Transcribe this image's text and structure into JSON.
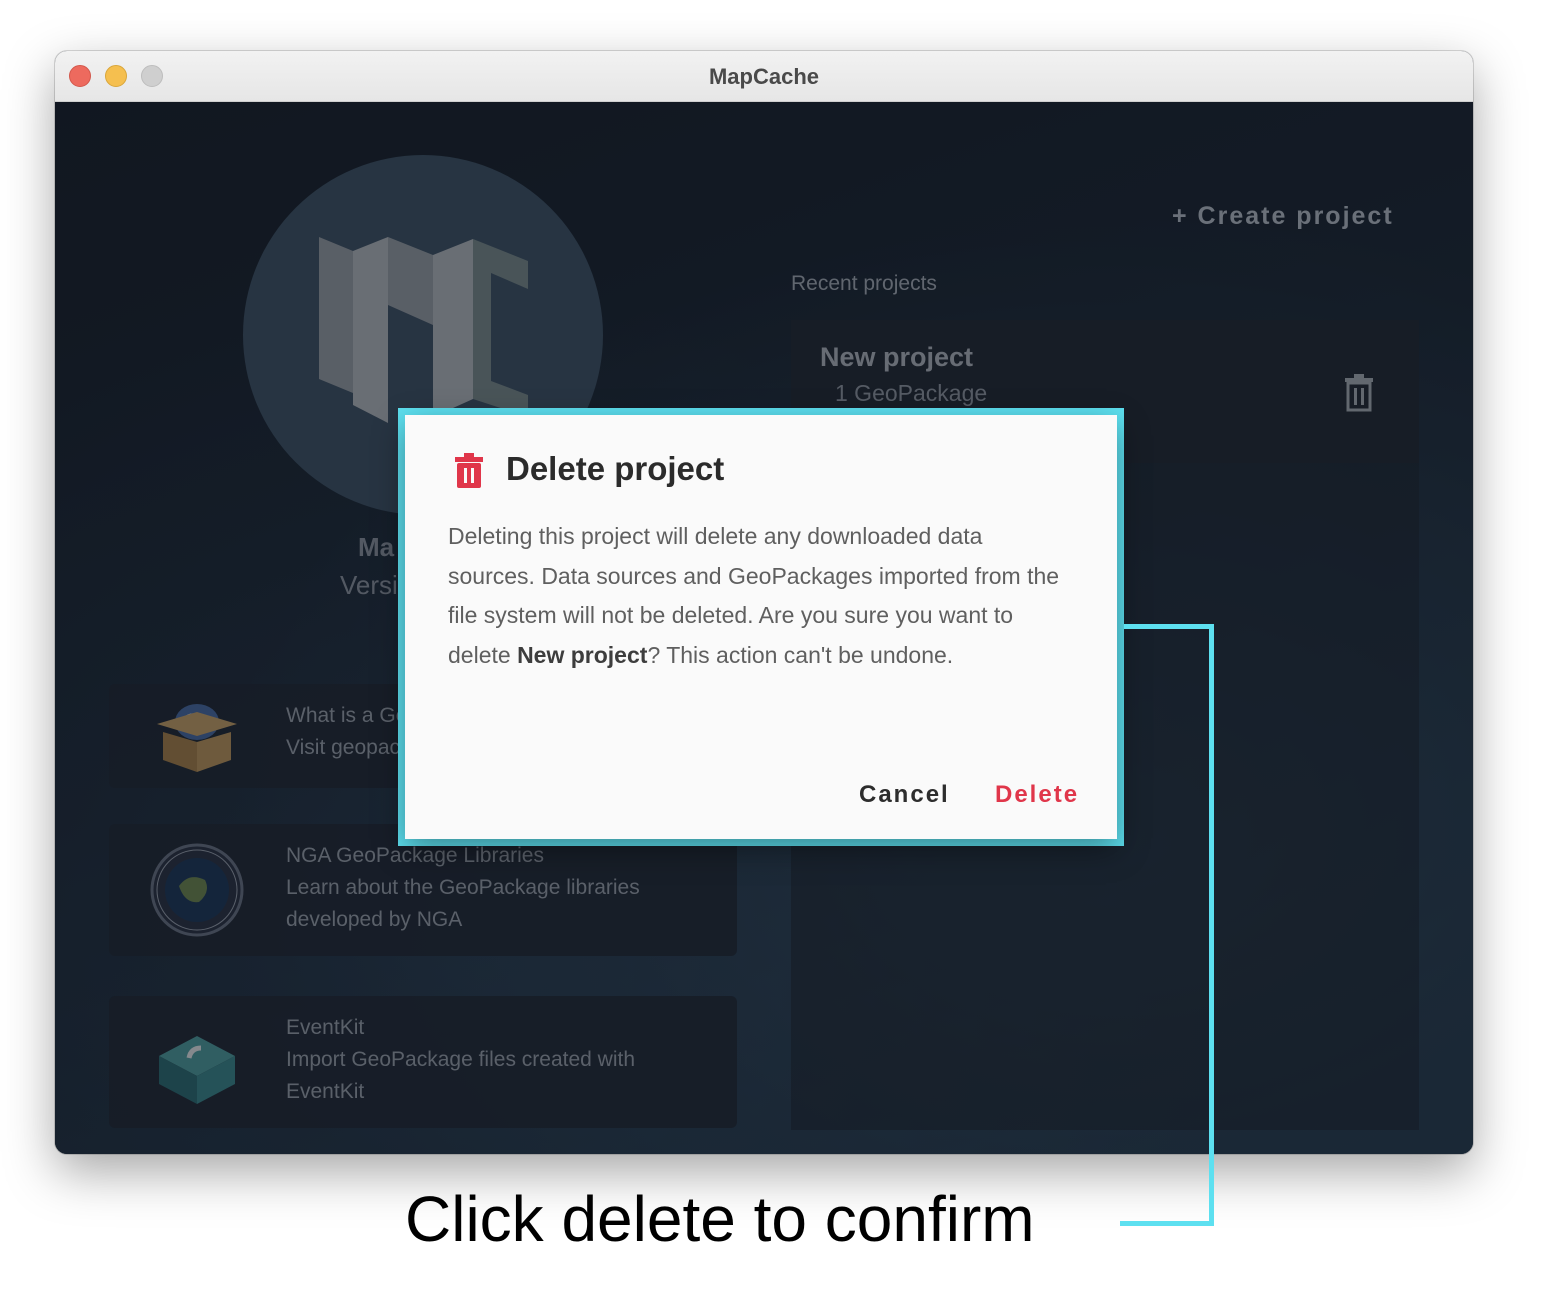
{
  "window": {
    "title": "MapCache"
  },
  "background": {
    "app_name_partial": "Ma",
    "version_partial": "Versi",
    "create_project_label": "+ Create project",
    "recent_projects_label": "Recent projects",
    "project": {
      "name": "New project",
      "subtitle": "1 GeoPackage"
    },
    "cards": [
      {
        "title": "What is a Ge",
        "subtitle": "Visit geopac",
        "icon": "geopackage-box-icon"
      },
      {
        "title": "NGA GeoPackage Libraries",
        "subtitle": "Learn about the GeoPackage libraries developed by NGA",
        "icon": "nga-seal-icon"
      },
      {
        "title": "EventKit",
        "subtitle": "Import GeoPackage files created with EventKit",
        "icon": "eventkit-cube-icon"
      }
    ]
  },
  "dialog": {
    "title": "Delete project",
    "body_before": "Deleting this project will delete any downloaded data sources. Data sources and GeoPackages imported from the file system will not be deleted. Are you sure you want to delete ",
    "body_bold": "New project",
    "body_after": "? This action can't be undone.",
    "cancel_label": "Cancel",
    "delete_label": "Delete"
  },
  "annotation": {
    "caption": "Click delete to confirm"
  },
  "colors": {
    "highlight": "#5de0f0",
    "danger": "#e0364a"
  }
}
